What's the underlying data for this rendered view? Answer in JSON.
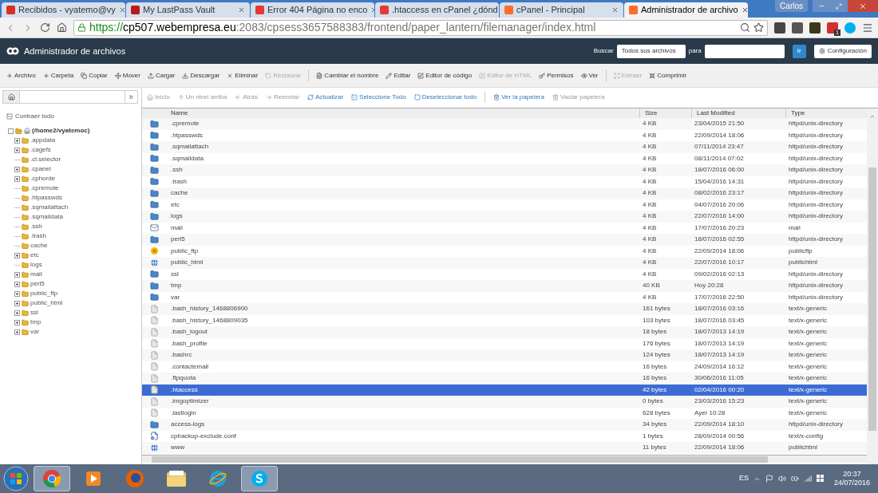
{
  "browser": {
    "user": "Carlos",
    "tabs": [
      {
        "title": "Recibidos - vyatemo@vy",
        "kind": "gmail",
        "selected": false
      },
      {
        "title": "My LastPass Vault",
        "kind": "lastpass",
        "selected": false
      },
      {
        "title": "Error 404 Página no enco",
        "kind": "webempresa",
        "selected": false
      },
      {
        "title": ".htaccess en cPanel ¿dónd",
        "kind": "webempresa",
        "selected": false
      },
      {
        "title": "cPanel - Principal",
        "kind": "cpanel",
        "selected": false
      },
      {
        "title": "Administrador de archivo",
        "kind": "cpanel",
        "selected": true
      }
    ],
    "url": {
      "scheme": "https://",
      "host": "cp507.webempresa.eu",
      "path": ":2083/cpsess3657588383/frontend/paper_lantern/filemanager/index.html"
    },
    "extension_badge": "1"
  },
  "header": {
    "title": "Administrador de archivos",
    "search_label": "Buscar",
    "scope": "Todos sus archivos",
    "for_label": "para",
    "go": "Ir",
    "settings": "Configuración"
  },
  "toolbar": [
    {
      "label": "Archivo",
      "disabled": false
    },
    {
      "label": "Carpeta",
      "disabled": false
    },
    {
      "label": "Copiar",
      "disabled": false
    },
    {
      "label": "Mover",
      "disabled": false
    },
    {
      "label": "Cargar",
      "disabled": false
    },
    {
      "label": "Descargar",
      "disabled": false
    },
    {
      "label": "Eliminar",
      "disabled": false
    },
    {
      "label": "Restaurar",
      "disabled": true
    },
    {
      "label": "Cambiar el nombre",
      "disabled": false
    },
    {
      "label": "Editar",
      "disabled": false
    },
    {
      "label": "Editor de código",
      "disabled": false
    },
    {
      "label": "Editor de HTML",
      "disabled": true
    },
    {
      "label": "Permisos",
      "disabled": false
    },
    {
      "label": "Ver",
      "disabled": false
    },
    {
      "label": "Extraer",
      "disabled": true
    },
    {
      "label": "Comprimir",
      "disabled": false
    }
  ],
  "path_bar": {
    "go": "Ir"
  },
  "nav": [
    {
      "label": "Inicio",
      "disabled": true
    },
    {
      "label": "Un nivel arriba",
      "disabled": true
    },
    {
      "label": "Atrás",
      "disabled": true
    },
    {
      "label": "Reenviar",
      "disabled": true
    },
    {
      "label": "Actualizar",
      "disabled": false
    },
    {
      "label": "Seleccione Todo",
      "disabled": false
    },
    {
      "label": "Deseleccionar todo",
      "disabled": false
    },
    {
      "label": "Ver la papelera",
      "disabled": false
    },
    {
      "label": "Vaciar papelera",
      "disabled": true
    }
  ],
  "tree": {
    "collapse_all": "Contraer todo",
    "root": {
      "label": "(/home2/vyatemoc)",
      "expanded": true,
      "children": [
        {
          "label": ".appdata",
          "expandable": true
        },
        {
          "label": ".cagefs",
          "expandable": true
        },
        {
          "label": ".cl.selector",
          "expandable": false
        },
        {
          "label": ".cpanel",
          "expandable": true
        },
        {
          "label": ".cphorde",
          "expandable": true
        },
        {
          "label": ".cpremote",
          "expandable": false
        },
        {
          "label": ".htpasswds",
          "expandable": false
        },
        {
          "label": ".sqmailattach",
          "expandable": false
        },
        {
          "label": ".sqmaildata",
          "expandable": false
        },
        {
          "label": ".ssh",
          "expandable": false
        },
        {
          "label": ".trash",
          "expandable": false
        },
        {
          "label": "cache",
          "expandable": false
        },
        {
          "label": "etc",
          "expandable": true
        },
        {
          "label": "logs",
          "expandable": false
        },
        {
          "label": "mail",
          "expandable": true
        },
        {
          "label": "perl5",
          "expandable": true
        },
        {
          "label": "public_ftp",
          "expandable": true
        },
        {
          "label": "public_html",
          "expandable": true
        },
        {
          "label": "ssl",
          "expandable": true
        },
        {
          "label": "tmp",
          "expandable": true
        },
        {
          "label": "var",
          "expandable": true
        }
      ]
    }
  },
  "table": {
    "columns": [
      "Name",
      "Size",
      "Last Modified",
      "Type"
    ],
    "rows": [
      {
        "kind": "folder",
        "name": ".cpremote",
        "size": "4 KB",
        "modified": "23/04/2015 21:50",
        "type": "httpd/unix-directory",
        "selected": false
      },
      {
        "kind": "folder",
        "name": ".htpasswds",
        "size": "4 KB",
        "modified": "22/09/2014 18:06",
        "type": "httpd/unix-directory",
        "selected": false
      },
      {
        "kind": "folder",
        "name": ".sqmailattach",
        "size": "4 KB",
        "modified": "07/11/2014 23:47",
        "type": "httpd/unix-directory",
        "selected": false
      },
      {
        "kind": "folder",
        "name": ".sqmaildata",
        "size": "4 KB",
        "modified": "08/11/2014 07:02",
        "type": "httpd/unix-directory",
        "selected": false
      },
      {
        "kind": "folder",
        "name": ".ssh",
        "size": "4 KB",
        "modified": "18/07/2016 06:00",
        "type": "httpd/unix-directory",
        "selected": false
      },
      {
        "kind": "folder",
        "name": ".trash",
        "size": "4 KB",
        "modified": "15/04/2016 14:31",
        "type": "httpd/unix-directory",
        "selected": false
      },
      {
        "kind": "folder",
        "name": "cache",
        "size": "4 KB",
        "modified": "08/02/2016 23:17",
        "type": "httpd/unix-directory",
        "selected": false
      },
      {
        "kind": "folder",
        "name": "etc",
        "size": "4 KB",
        "modified": "04/07/2016 20:06",
        "type": "httpd/unix-directory",
        "selected": false
      },
      {
        "kind": "folder",
        "name": "logs",
        "size": "4 KB",
        "modified": "22/07/2016 14:00",
        "type": "httpd/unix-directory",
        "selected": false
      },
      {
        "kind": "mail",
        "name": "mail",
        "size": "4 KB",
        "modified": "17/07/2016 20:23",
        "type": "mail",
        "selected": false
      },
      {
        "kind": "folder",
        "name": "perl5",
        "size": "4 KB",
        "modified": "18/07/2016 02:55",
        "type": "httpd/unix-directory",
        "selected": false
      },
      {
        "kind": "ftp",
        "name": "public_ftp",
        "size": "4 KB",
        "modified": "22/09/2014 18:06",
        "type": "publicftp",
        "selected": false
      },
      {
        "kind": "web",
        "name": "public_html",
        "size": "4 KB",
        "modified": "22/07/2016 10:17",
        "type": "publichtml",
        "selected": false
      },
      {
        "kind": "folder",
        "name": "ssl",
        "size": "4 KB",
        "modified": "09/02/2016 02:13",
        "type": "httpd/unix-directory",
        "selected": false
      },
      {
        "kind": "folder",
        "name": "tmp",
        "size": "40 KB",
        "modified": "Hoy 20:28",
        "type": "httpd/unix-directory",
        "selected": false
      },
      {
        "kind": "folder",
        "name": "var",
        "size": "4 KB",
        "modified": "17/07/2016 22:50",
        "type": "httpd/unix-directory",
        "selected": false
      },
      {
        "kind": "file",
        "name": ".bash_history_1468806900",
        "size": "161 bytes",
        "modified": "18/07/2016 03:16",
        "type": "text/x-generic",
        "selected": false
      },
      {
        "kind": "file",
        "name": ".bash_history_1468809035",
        "size": "103 bytes",
        "modified": "18/07/2016 03:45",
        "type": "text/x-generic",
        "selected": false
      },
      {
        "kind": "file",
        "name": ".bash_logout",
        "size": "18 bytes",
        "modified": "18/07/2013 14:19",
        "type": "text/x-generic",
        "selected": false
      },
      {
        "kind": "file",
        "name": ".bash_profile",
        "size": "176 bytes",
        "modified": "18/07/2013 14:19",
        "type": "text/x-generic",
        "selected": false
      },
      {
        "kind": "file",
        "name": ".bashrc",
        "size": "124 bytes",
        "modified": "18/07/2013 14:19",
        "type": "text/x-generic",
        "selected": false
      },
      {
        "kind": "file",
        "name": ".contactemail",
        "size": "16 bytes",
        "modified": "24/09/2014 16:12",
        "type": "text/x-generic",
        "selected": false
      },
      {
        "kind": "file",
        "name": ".ftpquota",
        "size": "16 bytes",
        "modified": "30/06/2016 11:05",
        "type": "text/x-generic",
        "selected": false
      },
      {
        "kind": "file",
        "name": ".htaccess",
        "size": "42 bytes",
        "modified": "02/04/2016 00:20",
        "type": "text/x-generic",
        "selected": true
      },
      {
        "kind": "file",
        "name": ".imgoptimizer",
        "size": "0 bytes",
        "modified": "23/03/2016 15:23",
        "type": "text/x-generic",
        "selected": false
      },
      {
        "kind": "file",
        "name": ".lastlogin",
        "size": "628 bytes",
        "modified": "Ayer 10:28",
        "type": "text/x-generic",
        "selected": false
      },
      {
        "kind": "folder",
        "name": "access-logs",
        "size": "34 bytes",
        "modified": "22/09/2014 18:10",
        "type": "httpd/unix-directory",
        "selected": false
      },
      {
        "kind": "config",
        "name": "cpbackup-exclude.conf",
        "size": "1 bytes",
        "modified": "28/09/2014 00:56",
        "type": "text/x-config",
        "selected": false
      },
      {
        "kind": "web",
        "name": "www",
        "size": "11 bytes",
        "modified": "22/09/2014 18:06",
        "type": "publichtml",
        "selected": false
      }
    ]
  },
  "taskbar": {
    "apps": [
      {
        "kind": "chrome",
        "selected": true
      },
      {
        "kind": "media",
        "selected": false
      },
      {
        "kind": "firefox",
        "selected": false
      },
      {
        "kind": "explorer",
        "selected": false
      },
      {
        "kind": "ie",
        "selected": false
      },
      {
        "kind": "skype",
        "selected": true
      }
    ],
    "language": "ES",
    "time": "20:37",
    "date": "24/07/2016"
  }
}
